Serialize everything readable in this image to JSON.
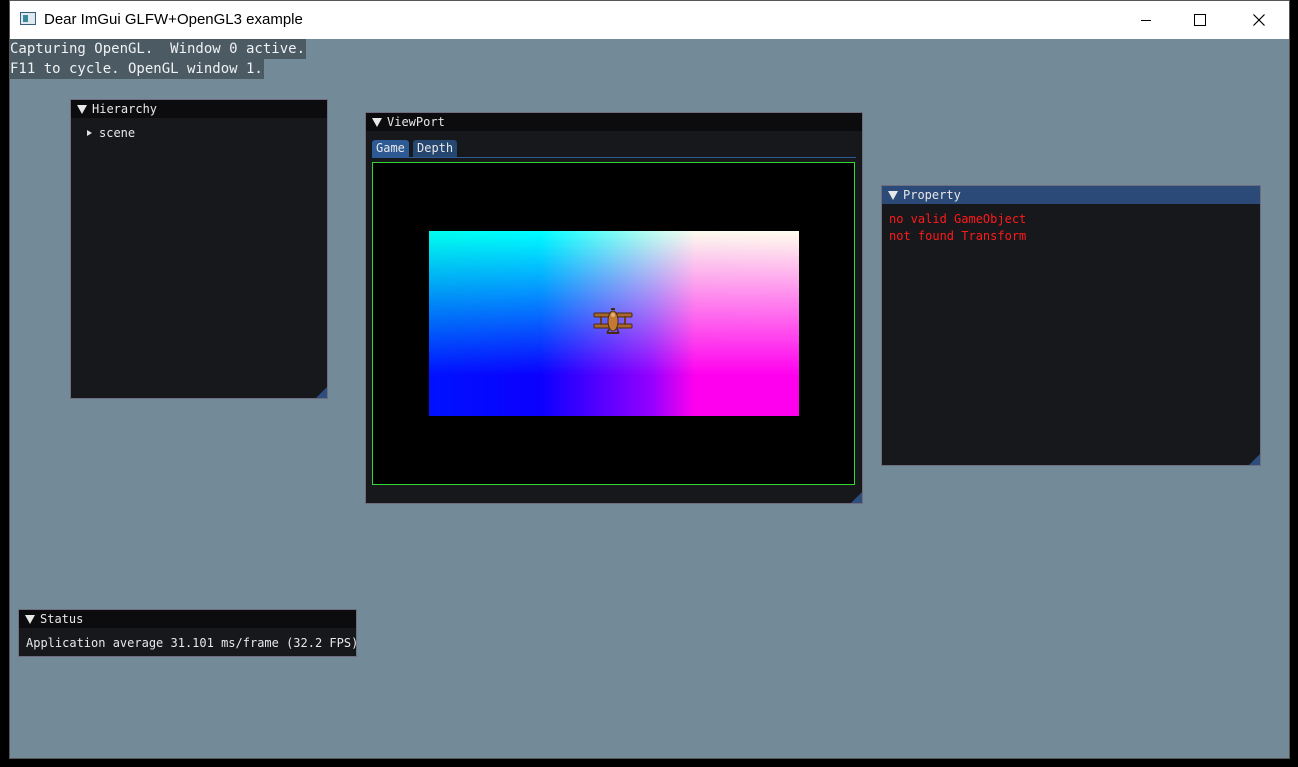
{
  "window": {
    "title": "Dear ImGui GLFW+OpenGL3 example",
    "controls": {
      "minimize": "minimize-icon",
      "maximize": "maximize-icon",
      "close": "close-icon"
    }
  },
  "overlay": {
    "line1": "Capturing OpenGL.  Window 0 active.",
    "line2": "F11 to cycle. OpenGL window 1."
  },
  "hierarchy": {
    "title": "Hierarchy",
    "items": [
      {
        "label": "scene",
        "expanded": false
      }
    ]
  },
  "viewport": {
    "title": "ViewPort",
    "tabs": [
      {
        "label": "Game",
        "active": true
      },
      {
        "label": "Depth",
        "active": false
      }
    ],
    "sprite": "biplane-sprite"
  },
  "property": {
    "title": "Property",
    "messages": [
      "no valid GameObject",
      "not found Transform"
    ],
    "message_color": "#ff1a1a"
  },
  "status": {
    "title": "Status",
    "text": "Application average 31.101 ms/frame (32.2 FPS)"
  },
  "colors": {
    "background": "#738b98",
    "panel_bg": "#16181c",
    "title_bg": "#0c0c0f",
    "title_active": "#2c4a78",
    "tab_active": "#2d5a94",
    "game_border": "#33d633"
  }
}
